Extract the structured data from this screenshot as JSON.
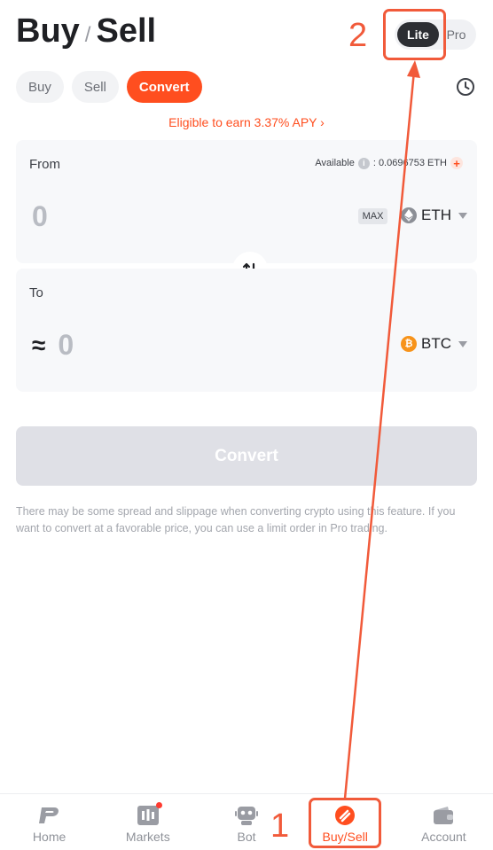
{
  "header": {
    "title_left": "Buy",
    "title_slash": "/",
    "title_right": "Sell",
    "mode_lite": "Lite",
    "mode_pro": "Pro"
  },
  "tabs": [
    {
      "label": "Buy",
      "active": false
    },
    {
      "label": "Sell",
      "active": false
    },
    {
      "label": "Convert",
      "active": true
    }
  ],
  "apy_banner": "Eligible to earn 3.37% APY ›",
  "from_card": {
    "label": "From",
    "available_label": "Available",
    "available_value": ": 0.0696753 ETH",
    "amount": "0",
    "max_label": "MAX",
    "coin": "ETH"
  },
  "swap_icon": "swap-arrows-icon",
  "to_card": {
    "label": "To",
    "approx_symbol": "≈",
    "amount": "0",
    "coin": "BTC"
  },
  "convert_button": "Convert",
  "disclaimer": "There may be some spread and slippage when converting crypto using this feature. If you want to convert at a favorable price, you can use a limit order in Pro trading.",
  "bottom_nav": [
    {
      "label": "Home",
      "icon": "home-logo-icon",
      "active": false
    },
    {
      "label": "Markets",
      "icon": "markets-icon",
      "active": false
    },
    {
      "label": "Bot",
      "icon": "bot-icon",
      "active": false
    },
    {
      "label": "Buy/Sell",
      "icon": "buy-sell-icon",
      "active": true
    },
    {
      "label": "Account",
      "icon": "wallet-icon",
      "active": false
    }
  ],
  "annotations": {
    "step1": "1",
    "step2": "2",
    "color": "#f15a3a"
  },
  "colors": {
    "accent": "#ff4e1f",
    "dark_toggle": "#2c2e33",
    "disabled_button": "#dfe0e6",
    "btc": "#f7931a"
  }
}
